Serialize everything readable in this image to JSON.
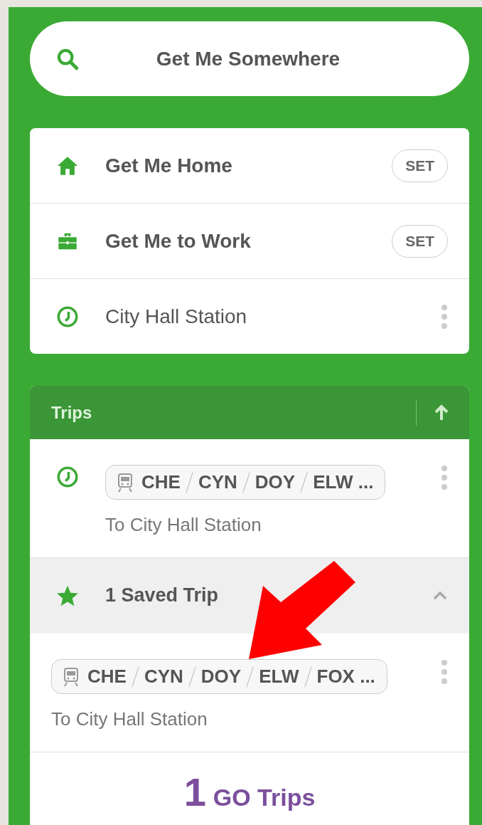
{
  "search": {
    "placeholder": "Get Me Somewhere"
  },
  "places": [
    {
      "kind": "home",
      "label": "Get Me Home",
      "action": "SET"
    },
    {
      "kind": "work",
      "label": "Get Me to Work",
      "action": "SET"
    },
    {
      "kind": "recent",
      "label": "City Hall Station"
    }
  ],
  "trips": {
    "title": "Trips",
    "items": [
      {
        "stops": [
          "CHE",
          "CYN",
          "DOY",
          "ELW ..."
        ],
        "destination": "To City Hall Station"
      }
    ],
    "saved": {
      "label": "1 Saved Trip",
      "expanded": true,
      "items": [
        {
          "stops": [
            "CHE",
            "CYN",
            "DOY",
            "ELW",
            "FOX ..."
          ],
          "destination": "To City Hall Station"
        }
      ]
    }
  },
  "go_trips": {
    "count": "1",
    "label": "GO Trips"
  }
}
